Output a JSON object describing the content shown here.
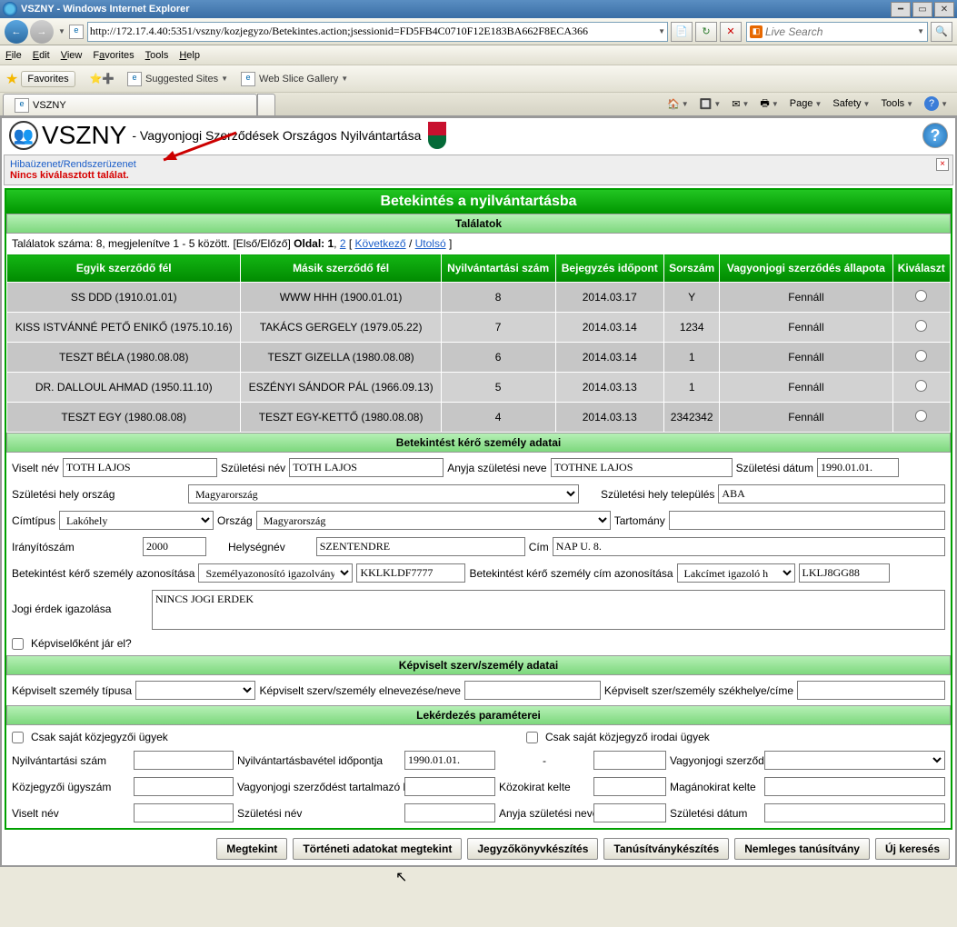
{
  "window": {
    "title": "VSZNY - Windows Internet Explorer",
    "url": "http://172.17.4.40:5351/vszny/kozjegyzo/Betekintes.action;jsessionid=FD5FB4C0710F12E183BA662F8ECA366",
    "search_placeholder": "Live Search"
  },
  "menus": [
    "File",
    "Edit",
    "View",
    "Favorites",
    "Tools",
    "Help"
  ],
  "favbar": {
    "favorites": "Favorites",
    "suggested": "Suggested Sites",
    "webslice": "Web Slice Gallery"
  },
  "tab": {
    "title": "VSZNY"
  },
  "toolbar_right": [
    "Page",
    "Safety",
    "Tools"
  ],
  "app": {
    "title": "VSZNY",
    "subtitle": "- Vagyonjogi Szerződések Országos Nyilvántartása"
  },
  "msg": {
    "link": "Hibaüzenet/Rendszerüzenet",
    "error": "Nincs kiválasztott találat."
  },
  "page_title": "Betekintés a nyilvántartásba",
  "results": {
    "header": "Találatok",
    "pager_text_a": "Találatok száma: 8, megjelenítve 1 - 5 között. [Első/Előző] ",
    "pager_oldal": "Oldal: 1",
    "pager_link2": "2",
    "pager_between": " [ ",
    "pager_next": "Következő",
    "pager_sep": "/ ",
    "pager_last": "Utolsó",
    "pager_end": "]",
    "columns": [
      "Egyik szerződő fél",
      "Másik szerződő fél",
      "Nyilvántartási szám",
      "Bejegyzés időpont",
      "Sorszám",
      "Vagyonjogi szerződés állapota",
      "Kiválaszt"
    ],
    "rows": [
      {
        "a": "SS DDD (1910.01.01)",
        "b": "WWW HHH (1900.01.01)",
        "c": "8",
        "d": "2014.03.17",
        "e": "Y",
        "f": "Fennáll"
      },
      {
        "a": "KISS ISTVÁNNÉ PETŐ ENIKŐ (1975.10.16)",
        "b": "TAKÁCS GERGELY (1979.05.22)",
        "c": "7",
        "d": "2014.03.14",
        "e": "1234",
        "f": "Fennáll"
      },
      {
        "a": "TESZT BÉLA (1980.08.08)",
        "b": "TESZT GIZELLA (1980.08.08)",
        "c": "6",
        "d": "2014.03.14",
        "e": "1",
        "f": "Fennáll"
      },
      {
        "a": "DR. DALLOUL AHMAD (1950.11.10)",
        "b": "ESZÉNYI SÁNDOR PÁL (1966.09.13)",
        "c": "5",
        "d": "2014.03.13",
        "e": "1",
        "f": "Fennáll"
      },
      {
        "a": "TESZT EGY (1980.08.08)",
        "b": "TESZT EGY-KETTŐ (1980.08.08)",
        "c": "4",
        "d": "2014.03.13",
        "e": "2342342",
        "f": "Fennáll"
      }
    ]
  },
  "person": {
    "header": "Betekintést kérő személy adatai",
    "viselt_nev_lbl": "Viselt név",
    "viselt_nev": "TOTH LAJOS",
    "szul_nev_lbl": "Születési név",
    "szul_nev": "TOTH LAJOS",
    "anyja_lbl": "Anyja születési neve",
    "anyja": "TOTHNE LAJOS",
    "szul_datum_lbl": "Születési dátum",
    "szul_datum": "1990.01.01.",
    "szul_orszag_lbl": "Születési hely ország",
    "szul_orszag": "Magyarország",
    "szul_telep_lbl": "Születési hely település",
    "szul_telep": "ABA",
    "cimtipus_lbl": "Címtípus",
    "cimtipus": "Lakóhely",
    "orszag_lbl": "Ország",
    "orszag": "Magyarország",
    "tartomany_lbl": "Tartomány",
    "irsz_lbl": "Irányítószám",
    "irsz": "2000",
    "helyseg_lbl": "Helységnév",
    "helyseg": "SZENTENDRE",
    "cim_lbl": "Cím",
    "cim": "NAP U. 8.",
    "azon_lbl": "Betekintést kérő személy azonosítása",
    "azon_type": "Személyazonosító igazolvány",
    "azon_num": "KKLKLDF7777",
    "cim_azon_lbl": "Betekintést kérő személy cím azonosítása",
    "cim_azon_type": "Lakcímet igazoló h",
    "cim_azon_num": "LKLJ8GG88",
    "jogi_lbl": "Jogi érdek igazolása",
    "jogi": "NINCS JOGI ERDEK",
    "kepviselo_lbl": "Képviselőként jár el?"
  },
  "repr": {
    "header": "Képviselt szerv/személy adatai",
    "tipus_lbl": "Képviselt személy típusa",
    "nev_lbl": "Képviselt szerv/személy elnevezése/neve",
    "szekhely_lbl": "Képviselt szer/személy székhelye/címe"
  },
  "query": {
    "header": "Lekérdezés paraméterei",
    "csak_sajat_lbl": "Csak saját közjegyzői ügyek",
    "csak_irodai_lbl": "Csak saját közjegyző irodai ügyek",
    "nyilv_lbl": "Nyilvántartási szám",
    "nyilv_ido_lbl": "Nyilvántartásbavétel időpontja",
    "nyilv_ido": "1990.01.01.",
    "dash": "-",
    "allapot_lbl": "Vagyonjogi szerződés állapota",
    "kozj_lbl": "Közjegyzői ügyszám",
    "kozokirat_lbl": "Vagyonjogi szerződést tartalmazó közokirat száma",
    "koz_kelte_lbl": "Közokirat kelte",
    "mag_kelte_lbl": "Magánokirat kelte",
    "q_viselt_lbl": "Viselt név",
    "q_szul_lbl": "Születési név",
    "q_anyja_lbl": "Anyja születési neve",
    "q_datum_lbl": "Születési dátum"
  },
  "buttons": {
    "megtekint": "Megtekint",
    "torteneti": "Történeti adatokat megtekint",
    "jegyzo": "Jegyzőkönyvkészítés",
    "tanus": "Tanúsítványkészítés",
    "nemleges": "Nemleges tanúsítvány",
    "ujkereses": "Új keresés"
  }
}
